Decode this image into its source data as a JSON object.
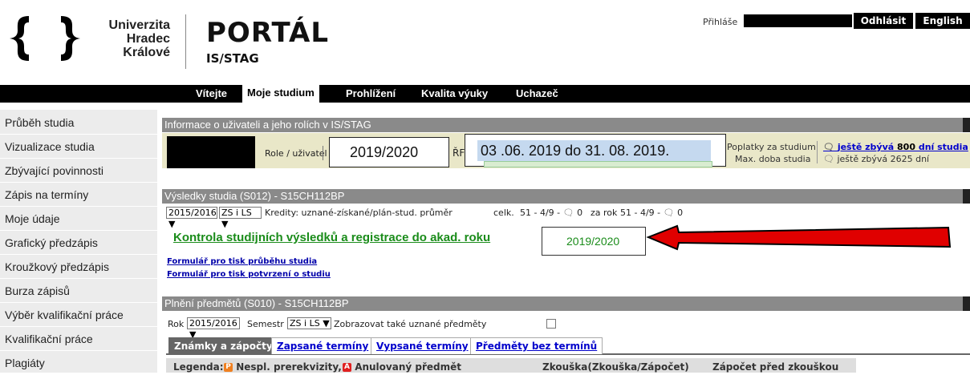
{
  "header": {
    "uni_line1": "Univerzita",
    "uni_line2": "Hradec",
    "uni_line3": "Králové",
    "portal_title": "PORTÁL",
    "portal_sub": "IS/STAG",
    "login_text": "Přihláše",
    "logout_label": "Odhlásit",
    "english_label": "English"
  },
  "nav": {
    "items": [
      "Vítejte",
      "Moje studium",
      "Prohlížení",
      "Kvalita výuky",
      "Uchazeč"
    ],
    "active": "Moje studium"
  },
  "sidebar": {
    "items": [
      "Průběh studia",
      "Vizualizace studia",
      "Zbývající povinnosti",
      "Zápis na termíny",
      "Moje údaje",
      "Grafický předzápis",
      "Kroužkový předzápis",
      "Burza zápisů",
      "Výběr kvalifikační práce",
      "Kvalifikační práce",
      "Plagiáty"
    ]
  },
  "info_panel": {
    "title": "Informace o uživateli a jeho rolích v IS/STAG",
    "role_label": "Role / uživatel",
    "year_overlay": "2019/2020",
    "rf_text": "ŘF",
    "date_overlay": "03 .06. 2019   do 31. 08. 2019.",
    "fees_label": "Poplatky za studium",
    "fees_value_prefix": "ještě zbývá ",
    "fees_value_bold": "800",
    "fees_value_suffix": " dní studia",
    "max_duration_label": "Max. doba studia",
    "max_duration_value": "ještě zbývá 2625 dní"
  },
  "results_panel": {
    "title": "Výsledky studia (S012) - S15CH112BP",
    "year_select": "2015/2016",
    "term_select": "ZS i LS",
    "credits_label": "Kredity: uznané-získané/plán-stud. průměr",
    "total_label": "celk.",
    "total_value": "51 - 4/9 - ",
    "total_zero": "0",
    "per_year_label": "za rok",
    "per_year_value": "51 - 4/9 - ",
    "per_year_zero": "0",
    "big_link": "Kontrola studijních výsledků a registrace do akad. roku",
    "year_overlay": "2019/2020",
    "link1": "Formulář pro tisk průběhu studia",
    "link2": "Formulář pro tisk potvrzení o studiu",
    "arrow_color": "#e00000"
  },
  "subjects_panel": {
    "title": "Plnění předmětů (S010) - S15CH112BP",
    "year_label": "Rok",
    "year_select": "2015/2016",
    "semester_label": "Semestr",
    "semester_select": "ZS i LS",
    "show_recognized": "Zobrazovat také uznané předměty",
    "tabs": [
      "Známky a zápočty",
      "Zapsané termíny",
      "Vypsané termíny",
      "Předměty bez termínů"
    ],
    "legend_label": "Legenda:",
    "legend_p": "Nespl. prerekvizity,",
    "legend_a": "Anulovaný předmět",
    "col_exam": "Zkouška(Zkouška/Zápočet)",
    "col_credit": "Zápočet před zkouškou"
  }
}
